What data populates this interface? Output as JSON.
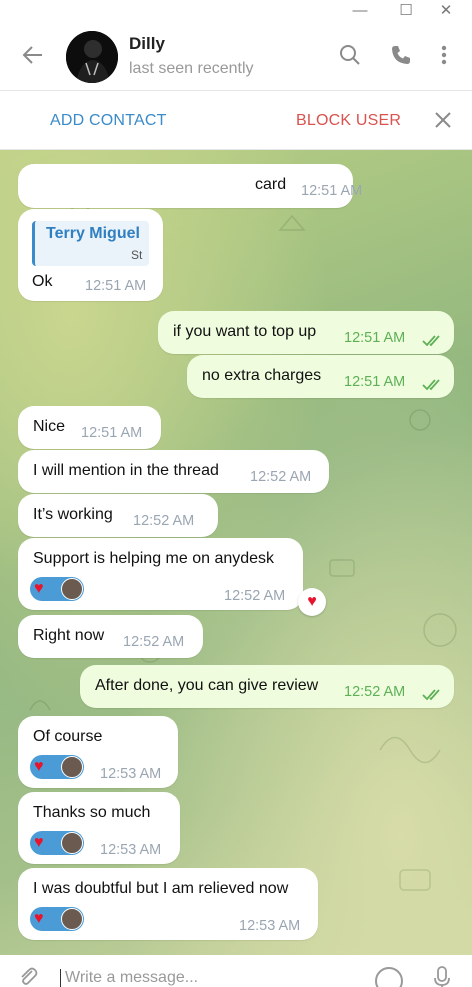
{
  "window": {
    "minimize": "—",
    "maximize": "☐",
    "close": "✕"
  },
  "header": {
    "name": "Dilly",
    "status": "last seen recently"
  },
  "actions": {
    "add_contact": "ADD CONTACT",
    "block_user": "BLOCK USER"
  },
  "messages": [
    {
      "text": "card",
      "time": "12:51 AM",
      "dir": "in"
    },
    {
      "reply_name": "Terry Miguel",
      "reply_text": "St",
      "text": "Ok",
      "time": "12:51 AM",
      "dir": "in"
    },
    {
      "text": "if you want to top up",
      "time": "12:51 AM",
      "dir": "out"
    },
    {
      "text": "no extra charges",
      "time": "12:51 AM",
      "dir": "out"
    },
    {
      "text": "Nice",
      "time": "12:51 AM",
      "dir": "in"
    },
    {
      "text": "I will mention in the thread",
      "time": "12:52 AM",
      "dir": "in"
    },
    {
      "text": "It’s working",
      "time": "12:52 AM",
      "dir": "in"
    },
    {
      "text": "Support is helping me on anydesk",
      "time": "12:52 AM",
      "dir": "in",
      "reaction": "heart"
    },
    {
      "text": "Right now",
      "time": "12:52 AM",
      "dir": "in"
    },
    {
      "text": "After done, you can give review",
      "time": "12:52 AM",
      "dir": "out"
    },
    {
      "text": "Of course",
      "time": "12:53 AM",
      "dir": "in",
      "reaction": "heart"
    },
    {
      "text": "Thanks so much",
      "time": "12:53 AM",
      "dir": "in",
      "reaction": "heart"
    },
    {
      "text": "I was doubtful but I am relieved now",
      "time": "12:53 AM",
      "dir": "in",
      "reaction": "heart"
    }
  ],
  "composer": {
    "placeholder": "Write a message..."
  },
  "colors": {
    "accent": "#3a8bc9",
    "danger": "#d9534f",
    "out_bubble": "#effdde",
    "heart": "#e8142c"
  },
  "icons": [
    "back-arrow-icon",
    "search-icon",
    "phone-icon",
    "more-vertical-icon",
    "close-icon",
    "attach-icon",
    "emoji-icon",
    "mic-icon",
    "double-check-icon",
    "heart-icon"
  ]
}
